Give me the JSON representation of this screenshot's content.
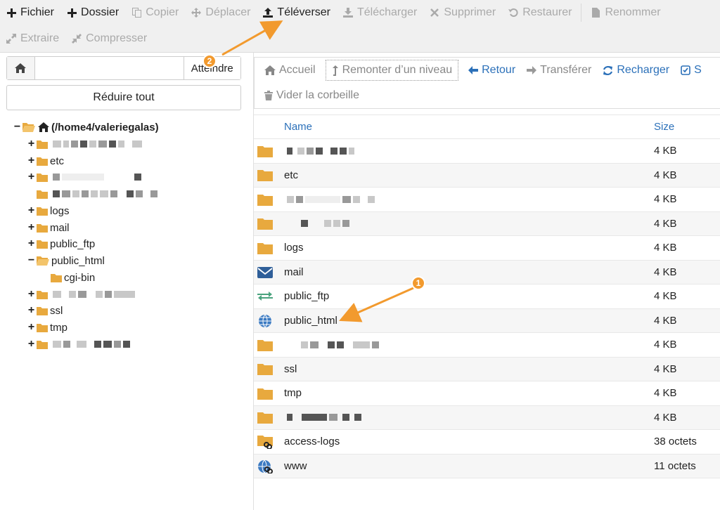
{
  "toolbar": {
    "row1": [
      {
        "label": "Fichier",
        "icon": "plus-icon",
        "enabled": true
      },
      {
        "label": "Dossier",
        "icon": "plus-icon",
        "enabled": true
      },
      {
        "label": "Copier",
        "icon": "copy-icon",
        "enabled": false
      },
      {
        "label": "Déplacer",
        "icon": "move-icon",
        "enabled": false
      },
      {
        "label": "Téléverser",
        "icon": "upload-icon",
        "enabled": true
      },
      {
        "label": "Télécharger",
        "icon": "download-icon",
        "enabled": false
      },
      {
        "label": "Supprimer",
        "icon": "close-icon",
        "enabled": false
      },
      {
        "label": "Restaurer",
        "icon": "undo-icon",
        "enabled": false
      },
      {
        "label": "Renommer",
        "icon": "file-icon",
        "enabled": false
      }
    ],
    "row2": [
      {
        "label": "Extraire",
        "icon": "expand-icon",
        "enabled": false
      },
      {
        "label": "Compresser",
        "icon": "compress-icon",
        "enabled": false
      }
    ]
  },
  "sidebar": {
    "path_value": "",
    "go_label": "Atteindre",
    "collapse_label": "Réduire tout",
    "root_label": "(/home4/valeriegalas)",
    "items": [
      {
        "toggle": "+",
        "label": ""
      },
      {
        "toggle": "+",
        "label": "etc"
      },
      {
        "toggle": "+",
        "label": ""
      },
      {
        "toggle": "",
        "label": ""
      },
      {
        "toggle": "+",
        "label": "logs"
      },
      {
        "toggle": "+",
        "label": "mail"
      },
      {
        "toggle": "+",
        "label": "public_ftp"
      },
      {
        "toggle": "−",
        "label": "public_html"
      },
      {
        "toggle": "",
        "label": "cgi-bin"
      },
      {
        "toggle": "+",
        "label": ""
      },
      {
        "toggle": "+",
        "label": "ssl"
      },
      {
        "toggle": "+",
        "label": "tmp"
      },
      {
        "toggle": "+",
        "label": ""
      }
    ]
  },
  "nav": {
    "home": "Accueil",
    "up": "Remonter d’un niveau",
    "back": "Retour",
    "forward": "Transférer",
    "reload": "Recharger",
    "select": "S",
    "empty_trash": "Vider la corbeille"
  },
  "table": {
    "col_name": "Name",
    "col_size": "Size",
    "rows": [
      {
        "icon": "folder-icon",
        "name": "",
        "size": "4 KB"
      },
      {
        "icon": "folder-icon",
        "name": "etc",
        "size": "4 KB"
      },
      {
        "icon": "folder-icon",
        "name": "",
        "size": "4 KB"
      },
      {
        "icon": "folder-icon",
        "name": "",
        "size": "4 KB"
      },
      {
        "icon": "folder-icon",
        "name": "logs",
        "size": "4 KB"
      },
      {
        "icon": "mail-icon",
        "name": "mail",
        "size": "4 KB"
      },
      {
        "icon": "transfer-icon",
        "name": "public_ftp",
        "size": "4 KB"
      },
      {
        "icon": "globe-icon",
        "name": "public_html",
        "size": "4 KB"
      },
      {
        "icon": "folder-icon",
        "name": "",
        "size": "4 KB"
      },
      {
        "icon": "folder-icon",
        "name": "ssl",
        "size": "4 KB"
      },
      {
        "icon": "folder-icon",
        "name": "tmp",
        "size": "4 KB"
      },
      {
        "icon": "folder-icon",
        "name": "",
        "size": "4 KB"
      },
      {
        "icon": "folder-link-icon",
        "name": "access-logs",
        "size": "38 octets"
      },
      {
        "icon": "globe-link-icon",
        "name": "www",
        "size": "11 octets"
      }
    ]
  },
  "annotations": {
    "badge1": "1",
    "badge2": "2"
  },
  "colors": {
    "accent": "#2b70b9",
    "folder": "#e8a93e",
    "badge": "#f29a2e"
  }
}
